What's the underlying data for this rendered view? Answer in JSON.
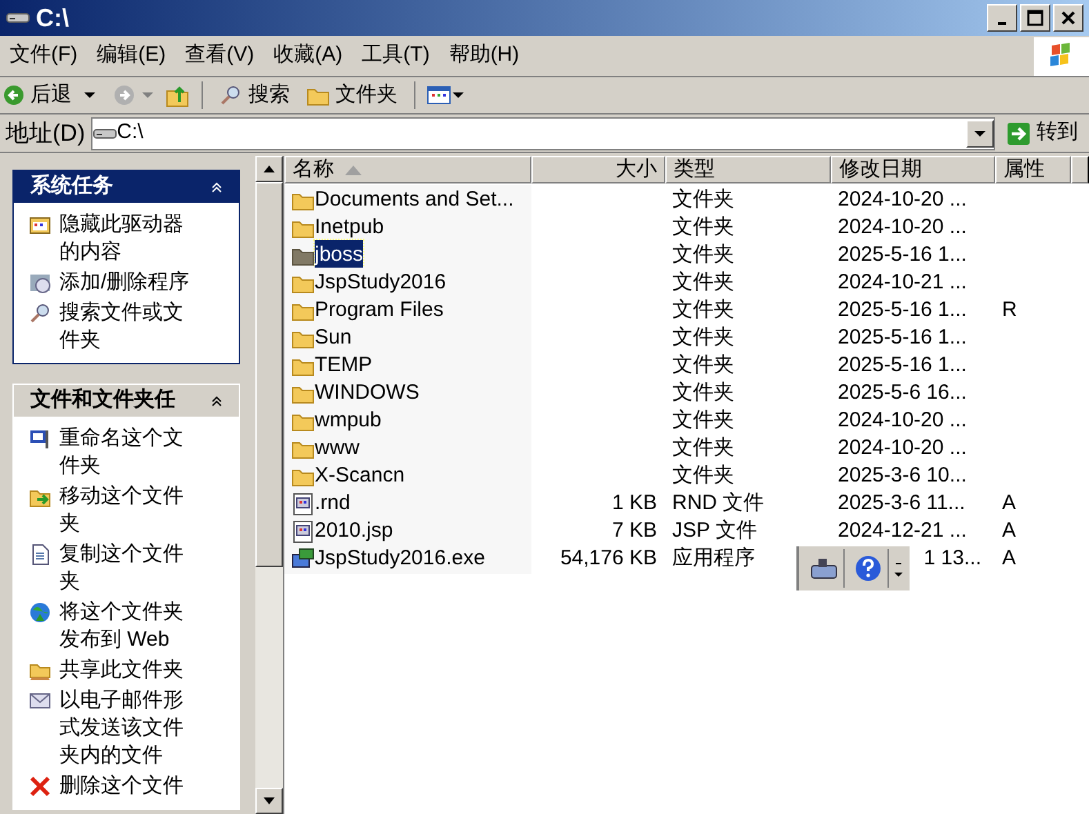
{
  "window": {
    "title": "C:\\"
  },
  "menu": [
    "文件(F)",
    "编辑(E)",
    "查看(V)",
    "收藏(A)",
    "工具(T)",
    "帮助(H)"
  ],
  "toolbar": {
    "back": "后退",
    "search": "搜索",
    "folders": "文件夹"
  },
  "address": {
    "label": "地址(D)",
    "value": "C:\\",
    "go": "转到"
  },
  "panels": [
    {
      "title": "系统任务",
      "items": [
        {
          "label": "隐藏此驱动器的内容"
        },
        {
          "label": "添加/删除程序"
        },
        {
          "label": "搜索文件或文件夹"
        }
      ]
    },
    {
      "title": "文件和文件夹任",
      "items": [
        {
          "label": "重命名这个文件夹"
        },
        {
          "label": "移动这个文件夹"
        },
        {
          "label": "复制这个文件夹"
        },
        {
          "label": "将这个文件夹发布到 Web"
        },
        {
          "label": "共享此文件夹"
        },
        {
          "label": "以电子邮件形式发送该文件夹内的文件"
        },
        {
          "label": "删除这个文件"
        }
      ]
    }
  ],
  "table": {
    "columns": [
      "名称",
      "大小",
      "类型",
      "修改日期",
      "属性"
    ],
    "rows": [
      {
        "kind": "folder",
        "name": "Documents and Set...",
        "type": "文件夹",
        "date": "2024-10-20 ...",
        "selected": false
      },
      {
        "kind": "folder",
        "name": "Inetpub",
        "type": "文件夹",
        "date": "2024-10-20 ...",
        "selected": false
      },
      {
        "kind": "folder",
        "name": "jboss",
        "type": "文件夹",
        "date": "2025-5-16 1...",
        "selected": true
      },
      {
        "kind": "folder",
        "name": "JspStudy2016",
        "type": "文件夹",
        "date": "2024-10-21 ...",
        "selected": false
      },
      {
        "kind": "folder",
        "name": "Program Files",
        "type": "文件夹",
        "date": "2025-5-16 1...",
        "attr": "R",
        "selected": false
      },
      {
        "kind": "folder",
        "name": "Sun",
        "type": "文件夹",
        "date": "2025-5-16 1...",
        "selected": false
      },
      {
        "kind": "folder",
        "name": "TEMP",
        "type": "文件夹",
        "date": "2025-5-16 1...",
        "selected": false
      },
      {
        "kind": "folder",
        "name": "WINDOWS",
        "type": "文件夹",
        "date": "2025-5-6 16...",
        "selected": false
      },
      {
        "kind": "folder",
        "name": "wmpub",
        "type": "文件夹",
        "date": "2024-10-20 ...",
        "selected": false
      },
      {
        "kind": "folder",
        "name": "www",
        "type": "文件夹",
        "date": "2024-10-20 ...",
        "selected": false
      },
      {
        "kind": "folder",
        "name": "X-Scancn",
        "type": "文件夹",
        "date": "2025-3-6 10...",
        "selected": false
      },
      {
        "kind": "file",
        "name": ".rnd",
        "size": "1 KB",
        "type": "RND 文件",
        "date": "2025-3-6 11...",
        "attr": "A",
        "selected": false
      },
      {
        "kind": "file",
        "name": "2010.jsp",
        "size": "7 KB",
        "type": "JSP 文件",
        "date": "2024-12-21 ...",
        "attr": "A",
        "selected": false
      },
      {
        "kind": "exe",
        "name": "JspStudy2016.exe",
        "size": "54,176 KB",
        "type": "应用程序",
        "date": "1 13...",
        "attr": "A",
        "selected": false
      }
    ]
  }
}
